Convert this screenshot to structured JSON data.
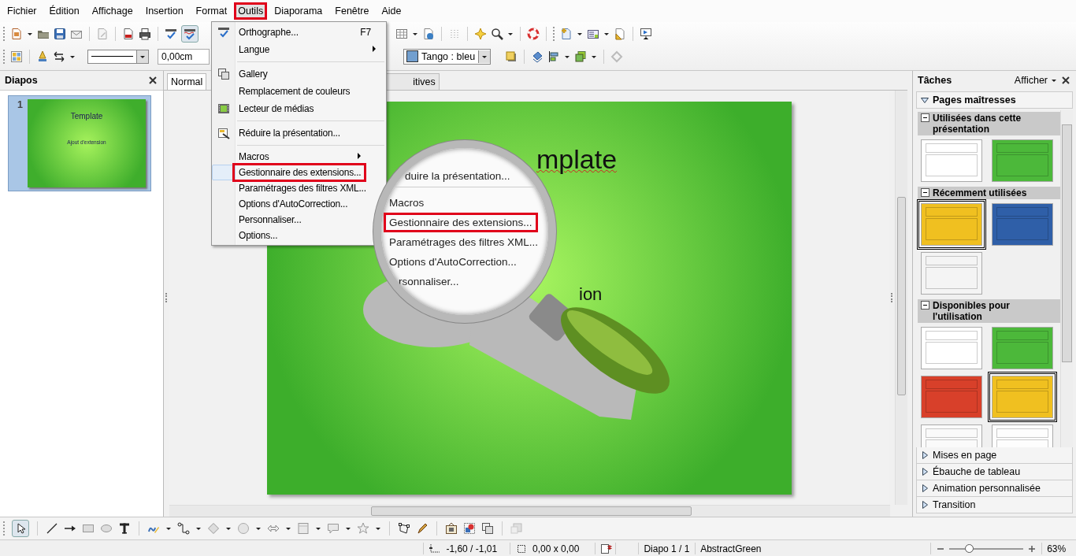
{
  "menubar": [
    {
      "label": "Fichier",
      "open": false
    },
    {
      "label": "Édition",
      "open": false
    },
    {
      "label": "Affichage",
      "open": false
    },
    {
      "label": "Insertion",
      "open": false
    },
    {
      "label": "Format",
      "open": false
    },
    {
      "label": "Outils",
      "open": true
    },
    {
      "label": "Diaporama",
      "open": false
    },
    {
      "label": "Fenêtre",
      "open": false
    },
    {
      "label": "Aide",
      "open": false
    }
  ],
  "menu": {
    "groups": [
      [
        {
          "label": "Orthographe...",
          "shortcut": "F7",
          "selected": false,
          "highlighted": false
        },
        {
          "label": "Langue",
          "submenu": true,
          "selected": false,
          "highlighted": false
        }
      ],
      [
        {
          "label": "Gallery",
          "selected": false,
          "highlighted": false
        },
        {
          "label": "Remplacement de couleurs",
          "selected": false,
          "highlighted": false
        },
        {
          "label": "Lecteur de médias",
          "selected": false,
          "highlighted": false
        }
      ],
      [
        {
          "label": "Réduire la présentation...",
          "selected": false,
          "highlighted": false
        }
      ],
      [
        {
          "label": "Macros",
          "submenu": true,
          "selected": false,
          "highlighted": false
        },
        {
          "label": "Gestionnaire des extensions...",
          "selected": true,
          "highlighted": true
        },
        {
          "label": "Paramétrages des filtres XML...",
          "selected": false,
          "highlighted": false
        },
        {
          "label": "Options d'AutoCorrection...",
          "selected": false,
          "highlighted": false
        },
        {
          "label": "Personnaliser...",
          "selected": false,
          "highlighted": false
        },
        {
          "label": "Options...",
          "selected": false,
          "highlighted": false
        }
      ]
    ]
  },
  "toolbar": {
    "autospell_on": true,
    "line_width": "0,00cm",
    "area_color": "Tango : bleu"
  },
  "slides_panel": {
    "title": "Diapos",
    "slides": [
      {
        "number": "1",
        "title": "Template",
        "subtitle": "Ajout d'extension",
        "selected": true
      }
    ]
  },
  "view_tabs": [
    {
      "label": "Normal",
      "selected": true
    },
    {
      "label": "itives",
      "selected": false
    }
  ],
  "slide": {
    "title": "mplate",
    "body": "ion"
  },
  "magnifier": {
    "groups": [
      [
        {
          "label": "duire la présentation...",
          "highlighted": false
        }
      ],
      [
        {
          "label": "Macros",
          "highlighted": false
        },
        {
          "label": "Gestionnaire des extensions...",
          "highlighted": true
        },
        {
          "label": "Paramétrages des filtres XML...",
          "highlighted": false
        },
        {
          "label": "Options d'AutoCorrection...",
          "highlighted": false
        },
        {
          "label": "rsonnaliser...",
          "highlighted": false
        }
      ]
    ]
  },
  "tasks_panel": {
    "title": "Tâches",
    "view_menu": "Afficher",
    "sections": [
      {
        "label": "Pages maîtresses",
        "expanded": true,
        "groups": [
          {
            "label": "Utilisées dans cette présentation",
            "thumbnails": [
              {
                "color": "#ffffff",
                "selected": false
              },
              {
                "color": "#4cb83a",
                "selected": false
              }
            ]
          },
          {
            "label": "Récemment utilisées",
            "thumbnails": [
              {
                "color": "#f0c020",
                "selected": true
              },
              {
                "color": "#2f5fa8",
                "selected": false
              },
              {
                "color": "#f4f4f4",
                "selected": false
              }
            ]
          },
          {
            "label": "Disponibles pour l'utilisation",
            "thumbnails": [
              {
                "color": "#ffffff",
                "selected": false
              },
              {
                "color": "#4cb83a",
                "selected": false
              },
              {
                "color": "#d8402a",
                "selected": false
              },
              {
                "color": "#f0c020",
                "selected": true
              },
              {
                "color": "#fafafa",
                "selected": false
              },
              {
                "color": "#fdfdfd",
                "selected": false
              }
            ]
          }
        ]
      },
      {
        "label": "Mises en page",
        "expanded": false
      },
      {
        "label": "Ébauche de tableau",
        "expanded": false
      },
      {
        "label": "Animation personnalisée",
        "expanded": false
      },
      {
        "label": "Transition",
        "expanded": false
      }
    ]
  },
  "draw_toolbar": {
    "select_on": true
  },
  "status_bar": {
    "position": "-1,60 / -1,01",
    "size": "0,00 x 0,00",
    "slide": "Diapo 1 / 1",
    "design": "AbstractGreen",
    "zoom": {
      "level": 0.27,
      "reading": "63%"
    }
  }
}
